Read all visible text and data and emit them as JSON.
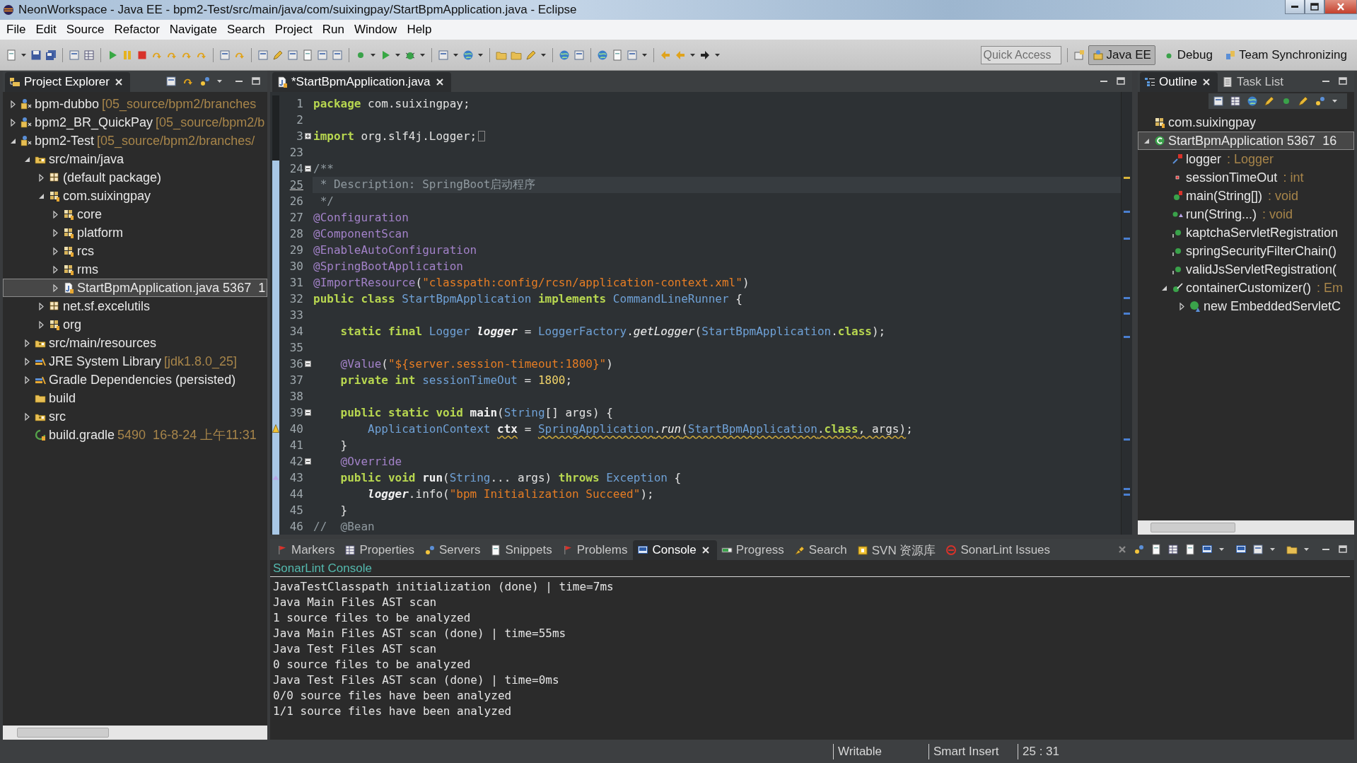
{
  "window": {
    "title": "NeonWorkspace - Java EE - bpm2-Test/src/main/java/com/suixingpay/StartBpmApplication.java - Eclipse"
  },
  "menu": [
    "File",
    "Edit",
    "Source",
    "Refactor",
    "Navigate",
    "Search",
    "Project",
    "Run",
    "Window",
    "Help"
  ],
  "toolbar": {
    "quick_access": {
      "placeholder": "Quick Access"
    },
    "perspectives": [
      {
        "label": "Java EE",
        "selected": true
      },
      {
        "label": "Debug",
        "selected": false
      },
      {
        "label": "Team Synchronizing",
        "selected": false
      }
    ]
  },
  "explorer": {
    "tabs": [
      {
        "label": "Project Explorer",
        "selected": true
      }
    ],
    "items": [
      {
        "label": "bpm-dubbo",
        "decoration": "[05_source/bpm2/branches",
        "kind": "project",
        "expanded": false,
        "selected": false
      },
      {
        "label": "bpm2_BR_QuickPay",
        "decoration": "[05_source/bpm2/b",
        "kind": "project",
        "expanded": false,
        "selected": false
      },
      {
        "label": "bpm2-Test",
        "decoration": "[05_source/bpm2/branches/",
        "kind": "project",
        "expanded": true,
        "selected": false,
        "children": [
          {
            "label": "src/main/java",
            "kind": "source-folder",
            "expanded": true,
            "selected": false,
            "children": [
              {
                "label": "(default package)",
                "kind": "empty-package",
                "expanded": false,
                "selected": false
              },
              {
                "label": "com.suixingpay",
                "kind": "package",
                "expanded": true,
                "selected": false,
                "children": [
                  {
                    "label": "core",
                    "kind": "package",
                    "expanded": false,
                    "selected": false
                  },
                  {
                    "label": "platform",
                    "kind": "package",
                    "expanded": false,
                    "selected": false
                  },
                  {
                    "label": "rcs",
                    "kind": "package",
                    "expanded": false,
                    "selected": false
                  },
                  {
                    "label": "rms",
                    "kind": "package",
                    "expanded": false,
                    "selected": false
                  },
                  {
                    "label": "StartBpmApplication.java 5367  1",
                    "kind": "java-file",
                    "expanded": false,
                    "selected": true
                  }
                ]
              },
              {
                "label": "net.sf.excelutils",
                "kind": "empty-package",
                "expanded": false,
                "selected": false
              },
              {
                "label": "org",
                "kind": "package",
                "expanded": false,
                "selected": false
              }
            ]
          },
          {
            "label": "src/main/resources",
            "kind": "source-folder",
            "expanded": false,
            "selected": false
          },
          {
            "label": "JRE System Library",
            "decoration": "[jdk1.8.0_25]",
            "kind": "library",
            "expanded": false,
            "selected": false
          },
          {
            "label": "Gradle Dependencies (persisted)",
            "kind": "library",
            "expanded": false,
            "selected": false
          },
          {
            "label": "build",
            "kind": "folder",
            "selected": false
          },
          {
            "label": "src",
            "kind": "source-folder",
            "expanded": false,
            "selected": false
          },
          {
            "label": "build.gradle",
            "decoration": "5490  16-8-24 上午11:31",
            "kind": "gradle-file",
            "selected": false
          }
        ]
      }
    ]
  },
  "editor": {
    "tab": {
      "label": "*StartBpmApplication.java",
      "selected": true
    },
    "lines": [
      {
        "number": "1",
        "current": false,
        "changed": false,
        "tokens": [
          {
            "kind": "keyword",
            "text": "package "
          },
          {
            "kind": "plain",
            "text": "com.suixingpay;"
          }
        ]
      },
      {
        "number": "2",
        "current": false,
        "changed": false
      },
      {
        "number": "3",
        "current": false,
        "changed": false,
        "folded": true,
        "tokens": [
          {
            "kind": "keyword",
            "text": "import "
          },
          {
            "kind": "plain",
            "text": "org.slf4j.Logger;"
          }
        ]
      },
      {
        "number": "23",
        "current": false,
        "changed": false
      },
      {
        "number": "24",
        "current": false,
        "changed": true,
        "folded": false,
        "tokens": [
          {
            "kind": "comment",
            "text": "/**"
          }
        ]
      },
      {
        "number": "25",
        "current": true,
        "changed": true,
        "tokens": [
          {
            "kind": "comment",
            "text": " * Description: SpringBoot启动程序"
          }
        ]
      },
      {
        "number": "26",
        "current": false,
        "changed": true,
        "tokens": [
          {
            "kind": "comment",
            "text": " */"
          }
        ]
      },
      {
        "number": "27",
        "current": false,
        "changed": true,
        "tokens": [
          {
            "kind": "annotation",
            "text": "@Configuration"
          }
        ]
      },
      {
        "number": "28",
        "current": false,
        "changed": true,
        "tokens": [
          {
            "kind": "annotation",
            "text": "@ComponentScan"
          }
        ]
      },
      {
        "number": "29",
        "current": false,
        "changed": true,
        "tokens": [
          {
            "kind": "annotation",
            "text": "@EnableAutoConfiguration"
          }
        ]
      },
      {
        "number": "30",
        "current": false,
        "changed": true,
        "tokens": [
          {
            "kind": "annotation",
            "text": "@SpringBootApplication"
          }
        ]
      },
      {
        "number": "31",
        "current": false,
        "changed": true,
        "tokens": [
          {
            "kind": "annotation",
            "text": "@ImportResource"
          },
          {
            "kind": "plain",
            "text": "("
          },
          {
            "kind": "string",
            "text": "\"classpath:config/rcsn/application-context.xml\""
          },
          {
            "kind": "plain",
            "text": ")"
          }
        ]
      },
      {
        "number": "32",
        "current": false,
        "changed": true,
        "tokens": [
          {
            "kind": "keyword",
            "text": "public class "
          },
          {
            "kind": "type",
            "text": "StartBpmApplication "
          },
          {
            "kind": "keyword",
            "text": "implements "
          },
          {
            "kind": "type",
            "text": "CommandLineRunner "
          },
          {
            "kind": "plain",
            "text": "{"
          }
        ]
      },
      {
        "number": "33",
        "current": false,
        "changed": true
      },
      {
        "number": "34",
        "current": false,
        "changed": true,
        "tokens": [
          {
            "kind": "keyword",
            "text": "    static final "
          },
          {
            "kind": "type",
            "text": "Logger "
          },
          {
            "kind": "static",
            "text": "logger"
          },
          {
            "kind": "plain",
            "text": " = "
          },
          {
            "kind": "type",
            "text": "LoggerFactory"
          },
          {
            "kind": "plain",
            "text": "."
          },
          {
            "kind": "method",
            "text": "getLogger"
          },
          {
            "kind": "plain",
            "text": "("
          },
          {
            "kind": "type",
            "text": "StartBpmApplication"
          },
          {
            "kind": "plain",
            "text": "."
          },
          {
            "kind": "keyword",
            "text": "class"
          },
          {
            "kind": "plain",
            "text": ");"
          }
        ]
      },
      {
        "number": "35",
        "current": false,
        "changed": true
      },
      {
        "number": "36",
        "current": false,
        "changed": true,
        "folded": false,
        "tokens": [
          {
            "kind": "annotation",
            "text": "    @Value"
          },
          {
            "kind": "plain",
            "text": "("
          },
          {
            "kind": "string",
            "text": "\"${server.session-timeout:1800}\""
          },
          {
            "kind": "plain",
            "text": ")"
          }
        ]
      },
      {
        "number": "37",
        "current": false,
        "changed": true,
        "tokens": [
          {
            "kind": "keyword",
            "text": "    private int "
          },
          {
            "kind": "field",
            "text": "sessionTimeOut"
          },
          {
            "kind": "plain",
            "text": " = "
          },
          {
            "kind": "number",
            "text": "1800"
          },
          {
            "kind": "plain",
            "text": ";"
          }
        ]
      },
      {
        "number": "38",
        "current": false,
        "changed": true
      },
      {
        "number": "39",
        "current": false,
        "changed": true,
        "folded": false,
        "tokens": [
          {
            "kind": "keyword",
            "text": "    public static void "
          },
          {
            "kind": "declaration",
            "text": "main"
          },
          {
            "kind": "plain",
            "text": "("
          },
          {
            "kind": "type",
            "text": "String"
          },
          {
            "kind": "plain",
            "text": "[] args) {"
          }
        ]
      },
      {
        "number": "40",
        "current": false,
        "changed": true,
        "warning": true,
        "tokens": [
          {
            "kind": "type",
            "text": "        ApplicationContext "
          },
          {
            "kind": "declaration",
            "text": "ctx",
            "squiggle": true
          },
          {
            "kind": "plain",
            "text": " = "
          },
          {
            "kind": "type",
            "text": "SpringApplication",
            "squiggle": true
          },
          {
            "kind": "plain",
            "text": ".",
            "squiggle": true
          },
          {
            "kind": "method",
            "text": "run",
            "squiggle": true
          },
          {
            "kind": "plain",
            "text": "(",
            "squiggle": true
          },
          {
            "kind": "type",
            "text": "StartBpmApplication",
            "squiggle": true
          },
          {
            "kind": "plain",
            "text": ".",
            "squiggle": true
          },
          {
            "kind": "keyword",
            "text": "class",
            "squiggle": true
          },
          {
            "kind": "plain",
            "text": ", args)",
            "squiggle": true
          },
          {
            "kind": "plain",
            "text": ";"
          }
        ]
      },
      {
        "number": "41",
        "current": false,
        "changed": true,
        "tokens": [
          {
            "kind": "plain",
            "text": "    }"
          }
        ]
      },
      {
        "number": "42",
        "current": false,
        "changed": true,
        "folded": false,
        "tokens": [
          {
            "kind": "annotation",
            "text": "    @Override"
          }
        ]
      },
      {
        "number": "43",
        "current": false,
        "changed": true,
        "overrides": true,
        "tokens": [
          {
            "kind": "keyword",
            "text": "    public void "
          },
          {
            "kind": "declaration",
            "text": "run"
          },
          {
            "kind": "plain",
            "text": "("
          },
          {
            "kind": "type",
            "text": "String"
          },
          {
            "kind": "plain",
            "text": "... args) "
          },
          {
            "kind": "keyword",
            "text": "throws "
          },
          {
            "kind": "type",
            "text": "Exception "
          },
          {
            "kind": "plain",
            "text": "{"
          }
        ]
      },
      {
        "number": "44",
        "current": false,
        "changed": true,
        "tokens": [
          {
            "kind": "static",
            "text": "        logger"
          },
          {
            "kind": "plain",
            "text": ".info("
          },
          {
            "kind": "string",
            "text": "\"bpm Initialization Succeed\""
          },
          {
            "kind": "plain",
            "text": ");"
          }
        ]
      },
      {
        "number": "45",
        "current": false,
        "changed": true,
        "tokens": [
          {
            "kind": "plain",
            "text": "    }"
          }
        ]
      },
      {
        "number": "46",
        "current": false,
        "changed": true,
        "tokens": [
          {
            "kind": "comment",
            "text": "//  @Bean"
          }
        ]
      }
    ]
  },
  "outline": {
    "tabs": [
      {
        "label": "Outline",
        "selected": true
      },
      {
        "label": "Task List",
        "selected": false
      }
    ],
    "items": [
      {
        "label": "com.suixingpay",
        "kind": "package",
        "selected": false
      },
      {
        "label": "StartBpmApplication 5367  16",
        "kind": "class",
        "expanded": true,
        "selected": true,
        "children": [
          {
            "label": "logger",
            "type": ": Logger",
            "kind": "static-field",
            "selected": false
          },
          {
            "label": "sessionTimeOut",
            "type": ": int",
            "kind": "private-field",
            "selected": false
          },
          {
            "label": "main(String[])",
            "type": ": void",
            "kind": "static-method",
            "selected": false
          },
          {
            "label": "run(String...)",
            "type": ": void",
            "kind": "override-method",
            "selected": false
          },
          {
            "label": "kaptchaServletRegistration",
            "kind": "method",
            "selected": false
          },
          {
            "label": "springSecurityFilterChain()",
            "kind": "method",
            "selected": false
          },
          {
            "label": "validJsServletRegistration(",
            "kind": "method",
            "selected": false
          },
          {
            "label": "containerCustomizer()",
            "type": ": Em",
            "kind": "bean-method",
            "expanded": true,
            "selected": false,
            "children": [
              {
                "label": "new EmbeddedServletC",
                "kind": "anonymous-class",
                "expanded": false,
                "selected": false
              }
            ]
          }
        ]
      }
    ]
  },
  "bottom": {
    "tabs": [
      {
        "label": "Markers",
        "selected": false
      },
      {
        "label": "Properties",
        "selected": false
      },
      {
        "label": "Servers",
        "selected": false
      },
      {
        "label": "Snippets",
        "selected": false
      },
      {
        "label": "Problems",
        "selected": false
      },
      {
        "label": "Console",
        "selected": true
      },
      {
        "label": "Progress",
        "selected": false
      },
      {
        "label": "Search",
        "selected": false
      },
      {
        "label": "SVN 资源库",
        "selected": false
      },
      {
        "label": "SonarLint Issues",
        "selected": false
      }
    ],
    "console": {
      "title": "SonarLint Console",
      "lines": [
        "JavaTestClasspath initialization (done) | time=7ms",
        "Java Main Files AST scan",
        "1 source files to be analyzed",
        "Java Main Files AST scan (done) | time=55ms",
        "Java Test Files AST scan",
        "0 source files to be analyzed",
        "Java Test Files AST scan (done) | time=0ms",
        "0/0 source files have been analyzed",
        "1/1 source files have been analyzed"
      ]
    }
  },
  "status_bar": [
    "Writable",
    "Smart Insert",
    "25 : 31"
  ]
}
